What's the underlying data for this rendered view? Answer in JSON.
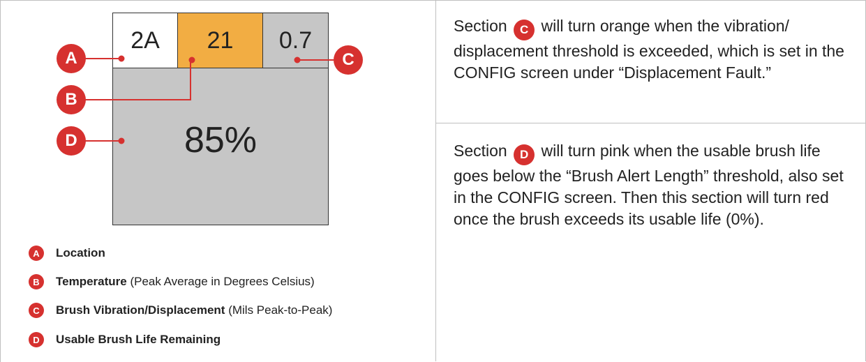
{
  "panel": {
    "cell_a": "2A",
    "cell_b": "21",
    "cell_c": "0.7",
    "cell_d": "85%",
    "colors": {
      "temperature": "#f2ad43",
      "gray": "#c6c6c6",
      "badge": "#d6312f"
    }
  },
  "badges": {
    "a": "A",
    "b": "B",
    "c": "C",
    "d": "D"
  },
  "legend": [
    {
      "badge": "A",
      "bold": "Location",
      "note": ""
    },
    {
      "badge": "B",
      "bold": "Temperature",
      "note": " (Peak Average in Degrees Celsius)"
    },
    {
      "badge": "C",
      "bold": "Brush Vibration/Displacement",
      "note": " (Mils Peak-to-Peak)"
    },
    {
      "badge": "D",
      "bold": "Usable Brush Life Remaining",
      "note": ""
    }
  ],
  "notes": {
    "section_c": {
      "prefix": "Section ",
      "badge": "C",
      "text": " will turn orange when the vibration/ displacement threshold is exceeded, which is set in the CONFIG screen under “Displacement Fault.”"
    },
    "section_d": {
      "prefix": "Section ",
      "badge": "D",
      "text": " will turn pink when the usable brush life goes below the “Brush Alert Length” threshold, also set in the CONFIG screen. Then this section will turn red once the brush exceeds its usable life (0%)."
    }
  }
}
